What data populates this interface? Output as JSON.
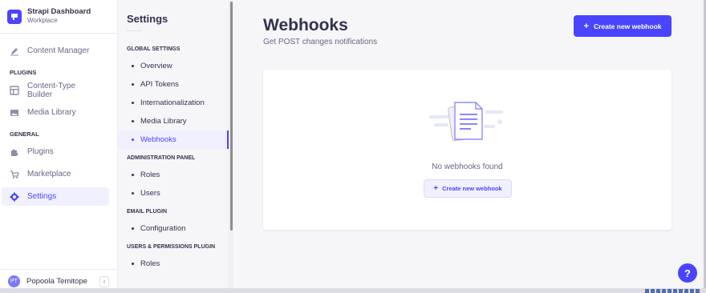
{
  "brand": {
    "title": "Strapi Dashboard",
    "subtitle": "Workplace",
    "logo_icon": "strapi-logo"
  },
  "leftnav": {
    "content_manager": "Content Manager",
    "plugins_group": "PLUGINS",
    "content_type_builder": "Content-Type Builder",
    "media_library": "Media Library",
    "general_group": "GENERAL",
    "plugins": "Plugins",
    "marketplace": "Marketplace",
    "settings": "Settings"
  },
  "user": {
    "initials": "PT",
    "name": "Popoola Temitope",
    "collapse_icon": "‹"
  },
  "subnav": {
    "title": "Settings",
    "global_group": "GLOBAL SETTINGS",
    "global_items": [
      "Overview",
      "API Tokens",
      "Internationalization",
      "Media Library",
      "Webhooks"
    ],
    "admin_group": "ADMINISTRATION PANEL",
    "admin_items": [
      "Roles",
      "Users"
    ],
    "email_group": "EMAIL PLUGIN",
    "email_items": [
      "Configuration"
    ],
    "users_perm_group": "USERS & PERMISSIONS PLUGIN",
    "users_perm_items": [
      "Roles"
    ]
  },
  "main": {
    "title": "Webhooks",
    "subtitle": "Get POST changes notifications",
    "create_button": "Create new webhook",
    "empty_text": "No webhooks found",
    "empty_button": "Create new webhook",
    "plus_glyph": "+"
  },
  "help": {
    "label": "?"
  },
  "colors": {
    "accent": "#4945ff",
    "active_bg": "#f0f0ff",
    "text": "#32324d",
    "muted": "#666687"
  }
}
